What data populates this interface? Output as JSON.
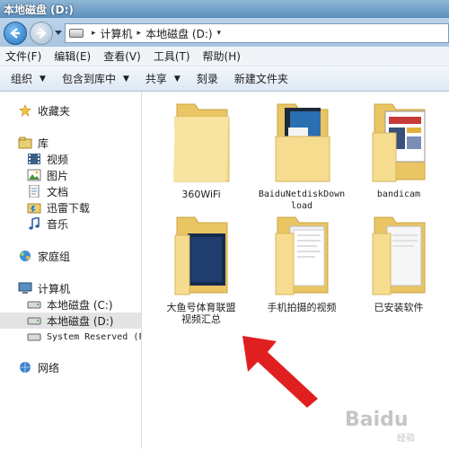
{
  "window": {
    "title": "本地磁盘 (D:)"
  },
  "address": {
    "crumbs": [
      "计算机",
      "本地磁盘 (D:)"
    ]
  },
  "menu": [
    "文件(F)",
    "编辑(E)",
    "查看(V)",
    "工具(T)",
    "帮助(H)"
  ],
  "toolbar": {
    "organize": "组织",
    "include_library": "包含到库中",
    "share": "共享",
    "burn": "刻录",
    "new_folder": "新建文件夹"
  },
  "sidebar": {
    "favorites": "收藏夹",
    "library": "库",
    "library_items": [
      "视频",
      "图片",
      "文档",
      "迅雷下载",
      "音乐"
    ],
    "homegroup": "家庭组",
    "computer": "计算机",
    "drives": [
      "本地磁盘 (C:)",
      "本地磁盘 (D:)",
      "System Reserved (F"
    ],
    "network": "网络"
  },
  "folders": [
    {
      "name": "360WiFi",
      "preview": "plain"
    },
    {
      "name": "BaiduNetdiskDownload",
      "preview": "blue-box"
    },
    {
      "name": "bandicam",
      "preview": "screenshot"
    },
    {
      "name": "大鱼号体育联盟视频汇总",
      "preview": "dark-box"
    },
    {
      "name": "手机拍摄的视频",
      "preview": "papers"
    },
    {
      "name": "已安装软件",
      "preview": "papers"
    }
  ],
  "watermark": {
    "text": "Baidu",
    "sub": "经验"
  },
  "colors": {
    "folder": "#f4d98b",
    "arrow": "#e02020",
    "selection": "#e4e4e4"
  }
}
